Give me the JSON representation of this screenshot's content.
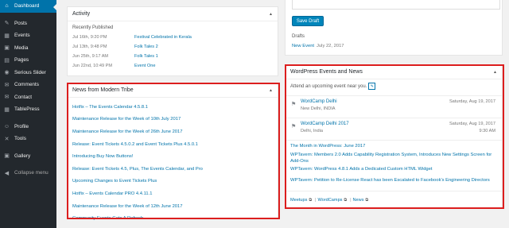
{
  "sidebar": {
    "items": [
      {
        "label": "Dashboard",
        "icon": "dashboard-icon",
        "glyph": "⌂"
      },
      {
        "label": "Posts",
        "icon": "pin-icon",
        "glyph": "✎"
      },
      {
        "label": "Events",
        "icon": "calendar-icon",
        "glyph": "▦"
      },
      {
        "label": "Media",
        "icon": "media-icon",
        "glyph": "▣"
      },
      {
        "label": "Pages",
        "icon": "page-icon",
        "glyph": "▤"
      },
      {
        "label": "Serious Slider",
        "icon": "slider-icon",
        "glyph": "◉"
      },
      {
        "label": "Comments",
        "icon": "comment-icon",
        "glyph": "✉"
      },
      {
        "label": "Contact",
        "icon": "mail-icon",
        "glyph": "✉"
      },
      {
        "label": "TablePress",
        "icon": "table-icon",
        "glyph": "▦"
      },
      {
        "label": "Profile",
        "icon": "user-icon",
        "glyph": "☺"
      },
      {
        "label": "Tools",
        "icon": "wrench-icon",
        "glyph": "✕"
      },
      {
        "label": "Gallery",
        "icon": "gallery-icon",
        "glyph": "▣"
      },
      {
        "label": "Collapse menu",
        "icon": "collapse-icon",
        "glyph": "◀"
      }
    ]
  },
  "activity": {
    "title": "Activity",
    "subtitle": "Recently Published",
    "rows": [
      {
        "date": "Jul 16th, 9:20 PM",
        "link": "Festival Celebrated in Kerala"
      },
      {
        "date": "Jul 13th, 9:48 PM",
        "link": "Folk Tales 2"
      },
      {
        "date": "Jun 25th, 9:17 AM",
        "link": "Folk Tales 1"
      },
      {
        "date": "Jun 22nd, 10:49 PM",
        "link": "Event One"
      }
    ]
  },
  "news": {
    "title": "News from Modern Tribe",
    "items": [
      "Hotfix – The Events Calendar 4.5.8.1",
      "Maintenance Release for the Week of 10th July 2017",
      "Maintenance Release for the Week of 26th June 2017",
      "Release: Event Tickets 4.5.0.2 and Event Tickets Plus 4.5.0.1",
      "Introducing Buy Now Buttons!",
      "Release: Event Tickets 4.5, Plus, The Events Calendar, and Pro",
      "Upcoming Changes to Event Tickets Plus",
      "Hotfix – Events Calendar PRO 4.4.11.1",
      "Maintenance Release for the Week of 12th June 2017",
      "Community Events Gets A Refresh"
    ]
  },
  "draft": {
    "save_label": "Save Draft",
    "drafts_label": "Drafts",
    "draft_link": "New Event",
    "draft_date": "July 22, 2017"
  },
  "events": {
    "title": "WordPress Events and News",
    "attend_text": "Attend an upcoming event near you.",
    "list": [
      {
        "title": "WordCamp Delhi",
        "location": "New Delhi, INDIA",
        "date": "Saturday, Aug 19, 2017",
        "time": ""
      },
      {
        "title": "WordCamp Delhi 2017",
        "location": "Delhi, India",
        "date": "Saturday, Aug 19, 2017",
        "time": "9:30 AM"
      }
    ],
    "news": [
      "The Month in WordPress: June 2017",
      "WPTavern: Members 2.0 Adds Capability Registration System, Introduces New Settings Screen for Add-Ons",
      "WPTavern: WordPress 4.8.1 Adds a Dedicated Custom HTML Widget",
      "WPTavern: Petition to Re-License React has been Escalated to Facebook's Engineering Directors"
    ],
    "footer": {
      "meetups": "Meetups",
      "wordcamps": "WordCamps",
      "news": "News"
    }
  },
  "colors": {
    "sidebar": "#23282d",
    "active": "#0073aa",
    "highlight": "#dc1e1e",
    "link": "#0073aa"
  }
}
